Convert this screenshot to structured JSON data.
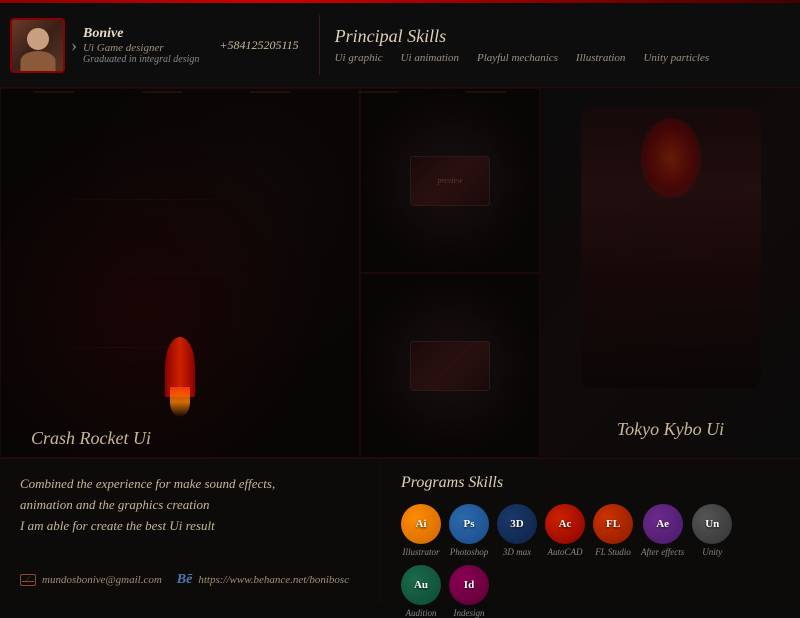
{
  "header": {
    "name": "Bonive",
    "role": "Ui Game designer",
    "graduation": "Graduated in integral design",
    "phone": "+584125205115",
    "principal_skills_title": "Principal Skills",
    "skills": [
      {
        "label": "Ui graphic"
      },
      {
        "label": "Ui animation"
      },
      {
        "label": "Playful mechanics"
      },
      {
        "label": "Illustration"
      },
      {
        "label": "Unity particles"
      }
    ]
  },
  "portfolio": {
    "items": [
      {
        "label": "Crash Rocket Ui"
      },
      {
        "label": "Tokyo Kybo Ui"
      }
    ]
  },
  "footer": {
    "bio_line1": "Combined the experience for make sound effects,",
    "bio_line2": "animation and the graphics creation",
    "bio_line3": "I am able for create the best Ui result",
    "email": "mundosbonive@gmail.com",
    "behance": "https://www.behance.net/bonibosc",
    "programs_title": "Programs Skills",
    "programs": [
      {
        "label": "Illustrator",
        "abbr": "Ai",
        "class": "icon-ai"
      },
      {
        "label": "Photoshop",
        "abbr": "Ps",
        "class": "icon-ps"
      },
      {
        "label": "3D max",
        "abbr": "3D",
        "class": "icon-3d"
      },
      {
        "label": "AutoCAD",
        "abbr": "Ac",
        "class": "icon-autocad"
      },
      {
        "label": "FL Studio",
        "abbr": "FL",
        "class": "icon-fl"
      },
      {
        "label": "After effects",
        "abbr": "Ae",
        "class": "icon-ae"
      },
      {
        "label": "Unity",
        "abbr": "Un",
        "class": "icon-unity"
      },
      {
        "label": "Audition",
        "abbr": "Au",
        "class": "icon-au"
      },
      {
        "label": "Indesign",
        "abbr": "Id",
        "class": "icon-id"
      }
    ]
  }
}
